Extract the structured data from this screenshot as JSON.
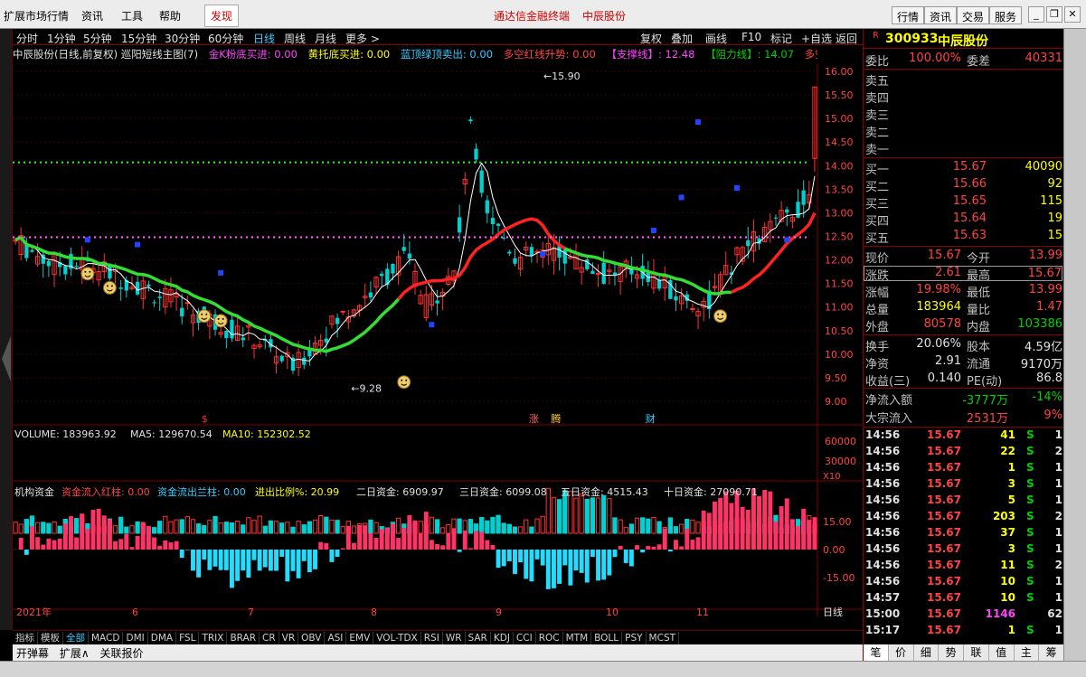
{
  "menu": {
    "items": [
      "扩展市场行情",
      "资讯",
      "工具",
      "帮助"
    ],
    "active": "发现",
    "title_left": "通达信金融终端",
    "title_right": "中辰股份",
    "right_buttons": [
      "行情",
      "资讯",
      "交易",
      "服务"
    ]
  },
  "period_tabs": [
    "分时",
    "1分钟",
    "5分钟",
    "15分钟",
    "30分钟",
    "60分钟",
    "日线",
    "周线",
    "月线",
    "更多 >"
  ],
  "period_active": "日线",
  "tools": [
    "复权",
    "叠加",
    "画线",
    "F10",
    "标记",
    "+自选",
    "返回"
  ],
  "info": {
    "name": "中辰股份(日线,前复权) 巡阳短线主图(7)",
    "s1": "金K粉底买进: 0.00",
    "s2": "黄托底买进: 0.00",
    "s3": "蓝顶绿顶卖出: 0.00",
    "s4": "多空红线升势: 0.00",
    "s5": "【支撑线】: 12.48",
    "s6": "【阻力线】: 14.07",
    "s7": "多空"
  },
  "price_axis": [
    "16.00",
    "15.50",
    "15.00",
    "14.50",
    "14.00",
    "13.50",
    "13.00",
    "12.50",
    "12.00",
    "11.50",
    "11.00",
    "10.50",
    "10.00",
    "9.50",
    "9.00"
  ],
  "annotations": {
    "high": "15.90",
    "low": "9.28"
  },
  "event_marks": {
    "s": "$",
    "zhang": "涨",
    "teng": "腾",
    "cai": "财"
  },
  "volume": {
    "label": "VOLUME: 183963.92",
    "ma5": "MA5: 129670.54",
    "ma10": "MA10: 152302.52",
    "axis": [
      "60000",
      "30000"
    ],
    "unit": "X10"
  },
  "fund": {
    "label": "机构资金",
    "in": "资金流入红柱: 0.00",
    "out": "资金流出兰柱: 0.00",
    "ratio": "进出比例%: 20.99",
    "d2": "二日资金: 6909.97",
    "d3": "三日资金: 6099.08",
    "d5": "五日资金: 4515.43",
    "d10": "十日资金: 27090.71",
    "axis": [
      "15.00",
      "0.00",
      "-15.00"
    ]
  },
  "months": [
    "2021年",
    "6",
    "7",
    "8",
    "9",
    "10",
    "11"
  ],
  "period_label": "日线",
  "indicators": [
    "指标",
    "模板",
    "全部",
    "MACD",
    "DMI",
    "DMA",
    "FSL",
    "TRIX",
    "BRAR",
    "CR",
    "VR",
    "OBV",
    "ASI",
    "EMV",
    "VOL-TDX",
    "RSI",
    "WR",
    "SAR",
    "KDJ",
    "CCI",
    "ROC",
    "MTM",
    "BOLL",
    "PSY",
    "MCST"
  ],
  "indicators_active": "全部",
  "bottom": [
    "开弹幕",
    "扩展∧",
    "关联报价"
  ],
  "stock": {
    "code": "300933",
    "name": "中辰股份",
    "r": "R"
  },
  "quote": {
    "weibi_label": "委比",
    "weibi": "100.00%",
    "weicha_label": "委差",
    "weicha": "40331",
    "sells": [
      "卖五",
      "卖四",
      "卖三",
      "卖二",
      "卖一"
    ],
    "buys": [
      {
        "l": "买一",
        "p": "15.67",
        "v": "40090"
      },
      {
        "l": "买二",
        "p": "15.66",
        "v": "92"
      },
      {
        "l": "买三",
        "p": "15.65",
        "v": "115"
      },
      {
        "l": "买四",
        "p": "15.64",
        "v": "19"
      },
      {
        "l": "买五",
        "p": "15.63",
        "v": "15"
      }
    ],
    "stats": [
      {
        "l": "现价",
        "v": "15.67",
        "l2": "今开",
        "v2": "13.99"
      },
      {
        "l": "涨跌",
        "v": "2.61",
        "l2": "最高",
        "v2": "15.67"
      },
      {
        "l": "涨幅",
        "v": "19.98%",
        "l2": "最低",
        "v2": "13.99"
      },
      {
        "l": "总量",
        "v": "183964",
        "l2": "量比",
        "v2": "1.47"
      },
      {
        "l": "外盘",
        "v": "80578",
        "l2": "内盘",
        "v2": "103386"
      }
    ],
    "stats2": [
      {
        "l": "换手",
        "v": "20.06%",
        "l2": "股本",
        "v2": "4.59亿"
      },
      {
        "l": "净资",
        "v": "2.91",
        "l2": "流通",
        "v2": "9170万"
      },
      {
        "l": "收益(三)",
        "v": "0.140",
        "l2": "PE(动)",
        "v2": "86.8"
      }
    ],
    "flow": [
      {
        "l": "净流入额",
        "v": "-3777万",
        "p": "-14%"
      },
      {
        "l": "大宗流入",
        "v": "2531万",
        "p": "9%"
      }
    ]
  },
  "ticks": [
    {
      "t": "14:56",
      "p": "15.67",
      "v": "41",
      "s": "S",
      "n": "1"
    },
    {
      "t": "14:56",
      "p": "15.67",
      "v": "22",
      "s": "S",
      "n": "2"
    },
    {
      "t": "14:56",
      "p": "15.67",
      "v": "1",
      "s": "S",
      "n": "1"
    },
    {
      "t": "14:56",
      "p": "15.67",
      "v": "3",
      "s": "S",
      "n": "1"
    },
    {
      "t": "14:56",
      "p": "15.67",
      "v": "5",
      "s": "S",
      "n": "1"
    },
    {
      "t": "14:56",
      "p": "15.67",
      "v": "203",
      "s": "S",
      "n": "2"
    },
    {
      "t": "14:56",
      "p": "15.67",
      "v": "37",
      "s": "S",
      "n": "1"
    },
    {
      "t": "14:56",
      "p": "15.67",
      "v": "3",
      "s": "S",
      "n": "1"
    },
    {
      "t": "14:56",
      "p": "15.67",
      "v": "11",
      "s": "S",
      "n": "2"
    },
    {
      "t": "14:56",
      "p": "15.67",
      "v": "10",
      "s": "S",
      "n": "1"
    },
    {
      "t": "14:57",
      "p": "15.67",
      "v": "10",
      "s": "S",
      "n": "1"
    },
    {
      "t": "15:00",
      "p": "15.67",
      "v": "1146",
      "s": "",
      "n": "62"
    },
    {
      "t": "15:17",
      "p": "15.67",
      "v": "1",
      "s": "S",
      "n": "1"
    }
  ],
  "rp_tabs": [
    "笔",
    "价",
    "细",
    "势",
    "联",
    "值",
    "主",
    "筹"
  ]
}
